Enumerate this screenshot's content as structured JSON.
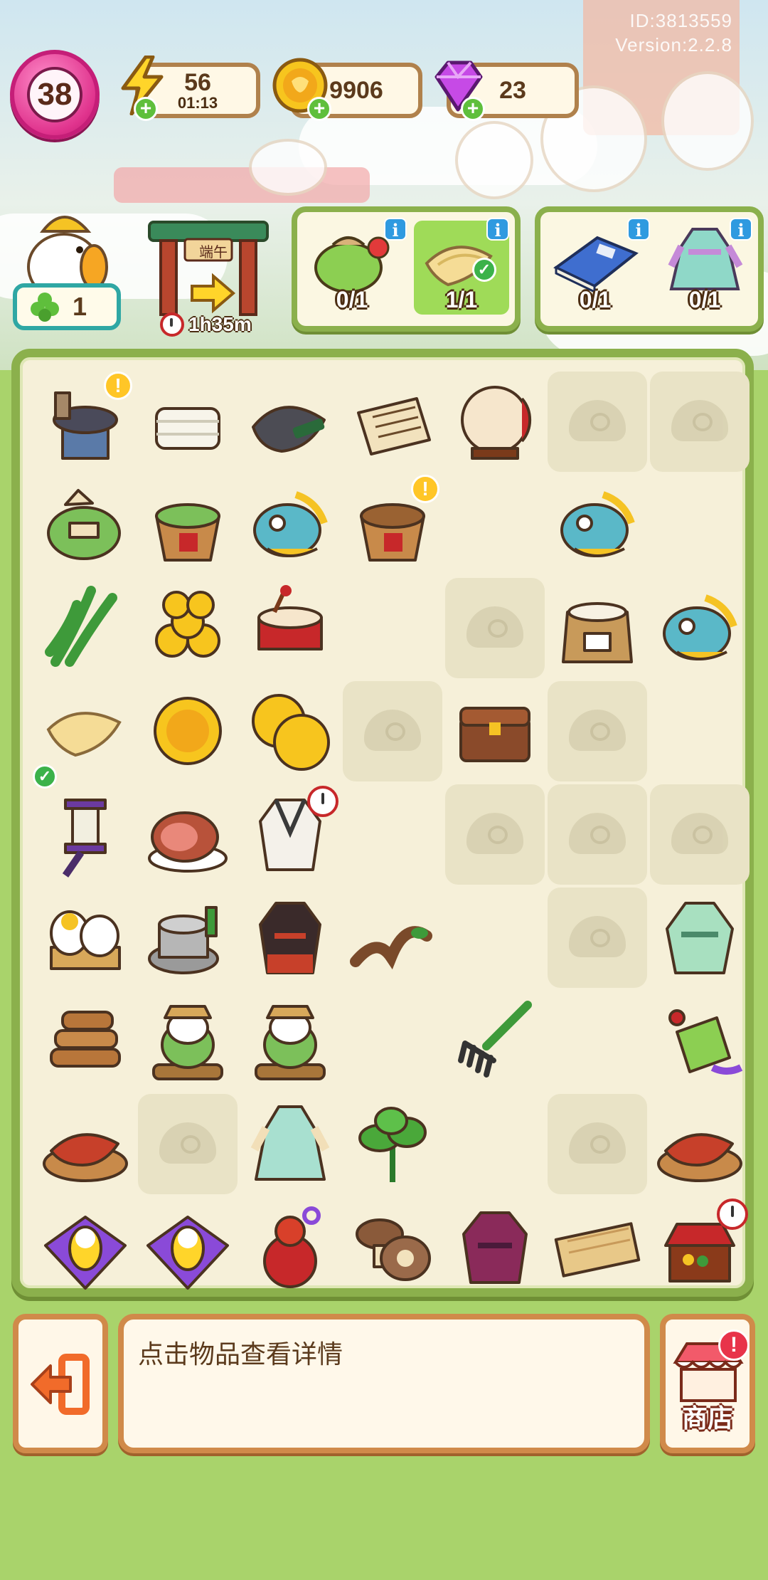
{
  "meta": {
    "id_text": "ID:3813559",
    "version_text": "Version:2.2.8"
  },
  "player": {
    "level": "38"
  },
  "resources": {
    "energy": {
      "value": "56",
      "timer": "01:13",
      "icon": "lightning-icon"
    },
    "coins": {
      "value": "9906",
      "icon": "coin-icon"
    },
    "gems": {
      "value": "23",
      "icon": "gem-icon"
    }
  },
  "helper": {
    "count": "1",
    "icon": "clover-icon"
  },
  "event_gate": {
    "timer": "1h35m",
    "sign_text": "端午"
  },
  "orders": [
    {
      "items": [
        {
          "icon": "sachet-icon",
          "count": "0/1",
          "done": false
        },
        {
          "icon": "cloth-icon",
          "count": "1/1",
          "done": true
        }
      ]
    },
    {
      "items": [
        {
          "icon": "book-icon",
          "count": "0/1",
          "done": false
        },
        {
          "icon": "hanfu-dress-icon",
          "count": "0/1",
          "done": false
        }
      ]
    }
  ],
  "board": {
    "rows": [
      [
        "stove-pot|alert",
        "tofu",
        "inkstone",
        "scroll",
        "drum",
        "locked",
        "locked"
      ],
      [
        "zongzi-bag",
        "zongzi-basket",
        "dragon-head",
        "empty-basket|alert",
        "empty",
        "dragon-head",
        "empty"
      ],
      [
        "reeds",
        "coin-pile",
        "drum-small",
        "empty",
        "locked",
        "rice-sack",
        "dragon-head"
      ],
      [
        "cloth|check",
        "coin",
        "two-coins",
        "locked",
        "chest",
        "locked",
        "empty"
      ],
      [
        "spool",
        "ham",
        "white-robe|timer",
        "empty",
        "locked",
        "locked",
        "locked"
      ],
      [
        "eggs",
        "millstone",
        "black-robe",
        "branch",
        "empty",
        "locked",
        "green-robe"
      ],
      [
        "firewood",
        "farmer-duck",
        "farmer-duck",
        "empty",
        "rake",
        "empty",
        "sachet-charm"
      ],
      [
        "bacon-plate",
        "locked",
        "blue-dress",
        "herb",
        "empty",
        "locked",
        "bacon-plate"
      ],
      [
        "kite",
        "kite",
        "red-gourd",
        "mushroom",
        "purple-robe",
        "wood-log",
        "market-stall|timer"
      ]
    ]
  },
  "detail": {
    "text": "点击物品查看详情"
  },
  "buttons": {
    "shop_label": "商店",
    "exit_icon": "exit-icon",
    "shop_icon": "shop-icon"
  },
  "colors": {
    "board_border": "#8bb04c",
    "panel_border": "#d08a4a",
    "level_badge": "#e0338d"
  }
}
